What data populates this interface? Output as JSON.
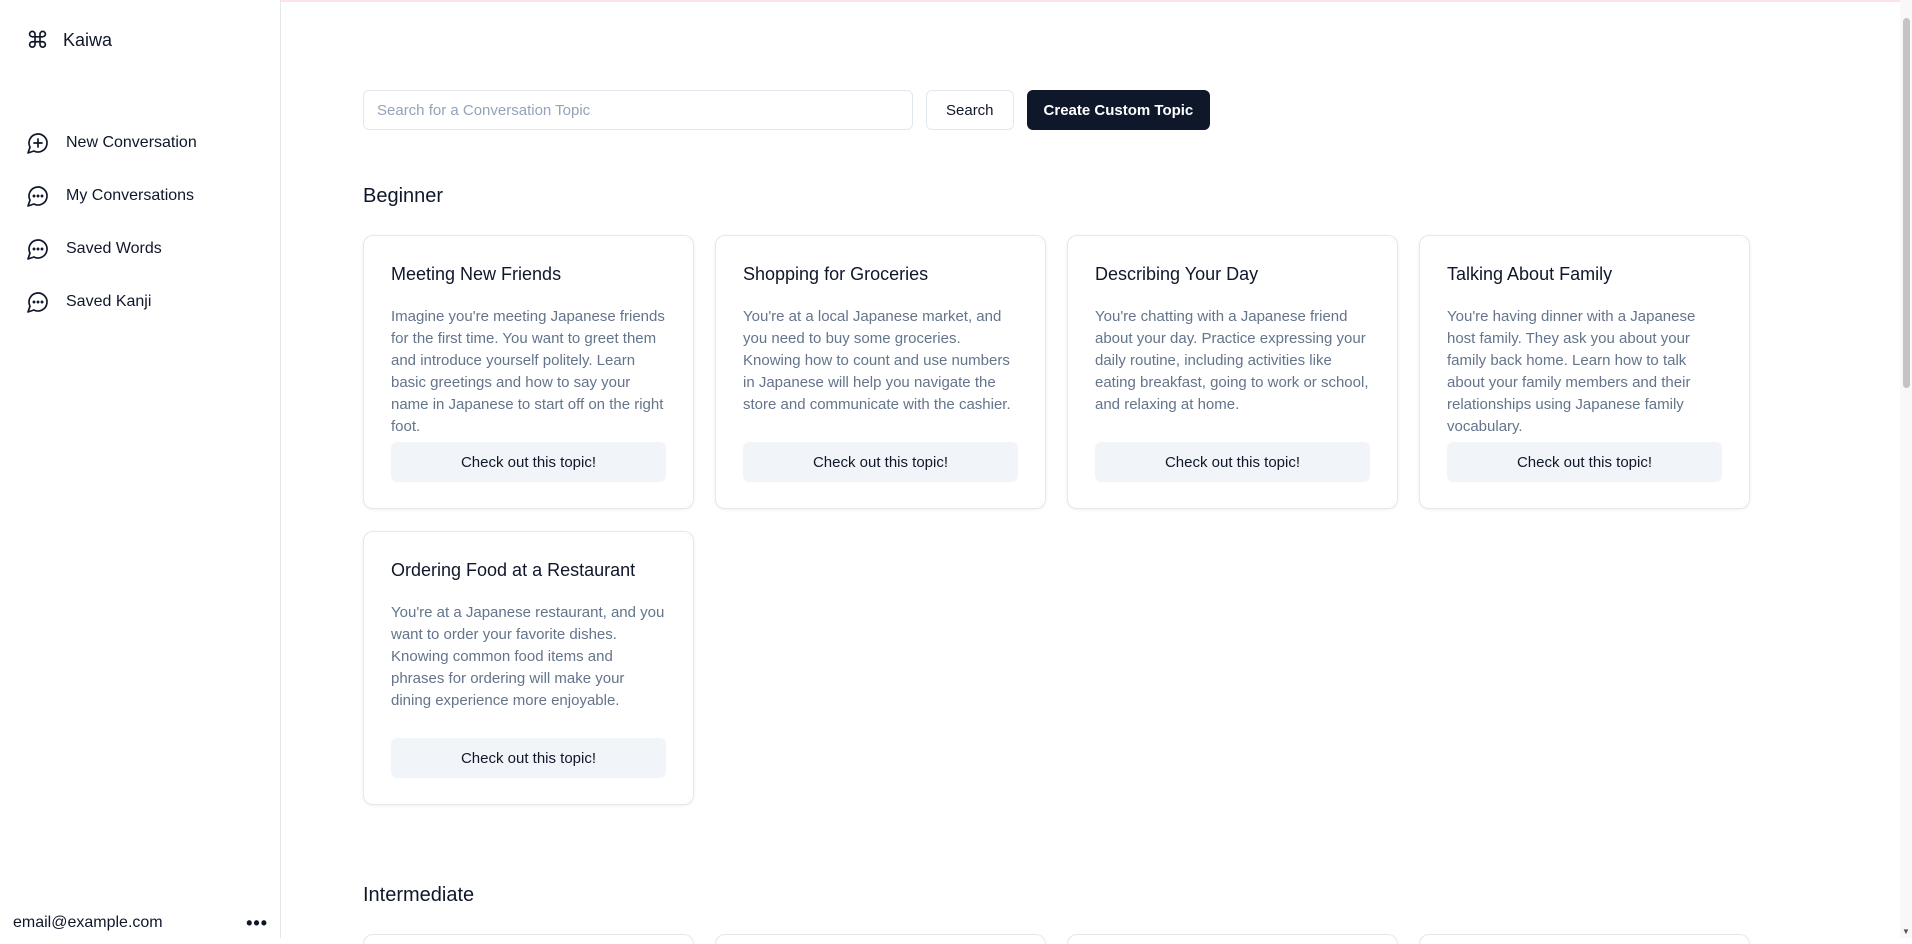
{
  "app": {
    "name": "Kaiwa"
  },
  "sidebar": {
    "items": [
      {
        "label": "New Conversation",
        "icon": "plus-circle-icon"
      },
      {
        "label": "My Conversations",
        "icon": "message-circle-icon"
      },
      {
        "label": "Saved Words",
        "icon": "message-circle-icon"
      },
      {
        "label": "Saved Kanji",
        "icon": "message-circle-icon"
      }
    ],
    "account_email": "email@example.com",
    "more_label": "•••"
  },
  "search": {
    "placeholder": "Search for a Conversation Topic",
    "value": "",
    "search_label": "Search",
    "create_label": "Create Custom Topic"
  },
  "sections": [
    {
      "title": "Beginner",
      "topics": [
        {
          "title": "Meeting New Friends",
          "description": "Imagine you're meeting Japanese friends for the first time. You want to greet them and introduce yourself politely. Learn basic greetings and how to say your name in Japanese to start off on the right foot.",
          "button": "Check out this topic!"
        },
        {
          "title": "Shopping for Groceries",
          "description": "You're at a local Japanese market, and you need to buy some groceries. Knowing how to count and use numbers in Japanese will help you navigate the store and communicate with the cashier.",
          "button": "Check out this topic!"
        },
        {
          "title": "Describing Your Day",
          "description": "You're chatting with a Japanese friend about your day. Practice expressing your daily routine, including activities like eating breakfast, going to work or school, and relaxing at home.",
          "button": "Check out this topic!"
        },
        {
          "title": "Talking About Family",
          "description": "You're having dinner with a Japanese host family. They ask you about your family back home. Learn how to talk about your family members and their relationships using Japanese family vocabulary.",
          "button": "Check out this topic!"
        },
        {
          "title": "Ordering Food at a Restaurant",
          "description": "You're at a Japanese restaurant, and you want to order your favorite dishes. Knowing common food items and phrases for ordering will make your dining experience more enjoyable.",
          "button": "Check out this topic!"
        }
      ]
    },
    {
      "title": "Intermediate",
      "topics": []
    }
  ],
  "colors": {
    "primary_dark": "#0f172a",
    "muted_text": "#64748b",
    "muted_bg": "#f1f5f9",
    "border": "#e5e7eb"
  }
}
